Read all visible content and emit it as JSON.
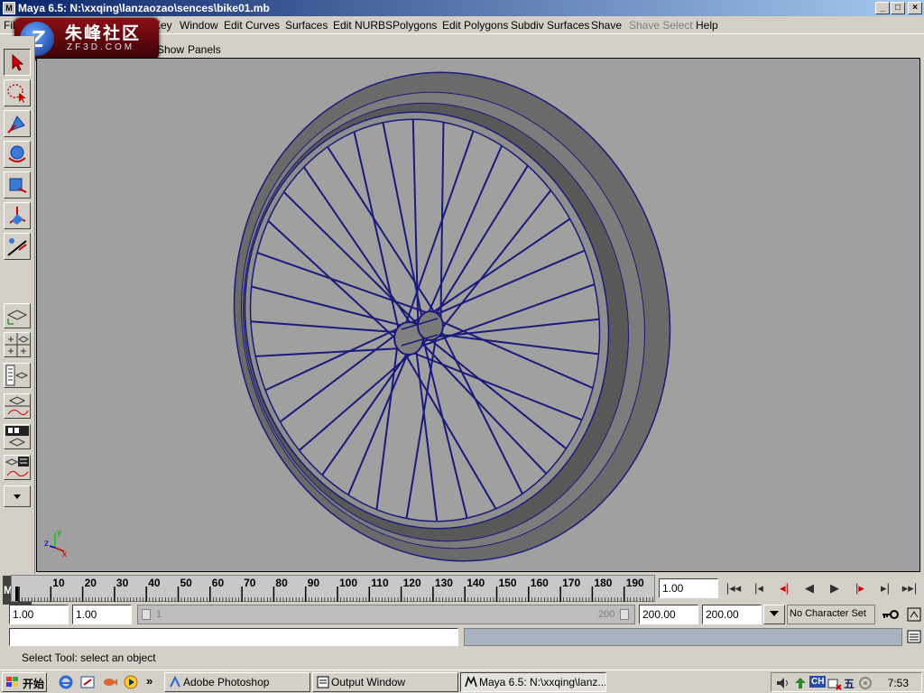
{
  "window": {
    "title": "Maya 6.5: N:\\xxqing\\lanzaozao\\sences\\bike01.mb",
    "min_glyph": "_",
    "max_glyph": "□",
    "close_glyph": "×"
  },
  "watermark": {
    "chinese": "朱峰社区",
    "site": "ZF3D.COM",
    "mark": "Z"
  },
  "menubar": {
    "items": [
      {
        "label": "File",
        "enabled": true
      },
      {
        "label": "Key",
        "enabled": true
      },
      {
        "label": "Window",
        "enabled": true
      },
      {
        "label": "Edit Curves",
        "enabled": true
      },
      {
        "label": "Surfaces",
        "enabled": true
      },
      {
        "label": "Edit NURBS",
        "enabled": true
      },
      {
        "label": "Polygons",
        "enabled": true
      },
      {
        "label": "Edit Polygons",
        "enabled": true
      },
      {
        "label": "Subdiv Surfaces",
        "enabled": true
      },
      {
        "label": "Shave",
        "enabled": true
      },
      {
        "label": "Shave Select",
        "enabled": false
      },
      {
        "label": "Help",
        "enabled": true
      }
    ]
  },
  "panel_menu": {
    "items": [
      "Show",
      "Panels"
    ]
  },
  "toolbox": {
    "tools": [
      "select-tool",
      "lasso-tool",
      "move-tool",
      "rotate-tool",
      "scale-tool",
      "manipulator-tool",
      "last-used-tool"
    ],
    "maya_logo": "Maya"
  },
  "viewport": {
    "axis_labels": {
      "x": "x",
      "y": "y",
      "z": "z"
    },
    "background": "#a0a0a0",
    "wire_color": "#1a1a7a"
  },
  "time_slider": {
    "ticks": [
      "10",
      "20",
      "30",
      "40",
      "50",
      "60",
      "70",
      "80",
      "90",
      "100",
      "110",
      "120",
      "130",
      "140",
      "150",
      "160",
      "170",
      "180",
      "190",
      "2"
    ],
    "current_time": "1.00"
  },
  "range_slider": {
    "start_time": "1.00",
    "playback_start": "1.00",
    "range_start_label": "1",
    "range_end_label": "200",
    "playback_end": "200.00",
    "end_time": "200.00",
    "character_set": "No Character Set"
  },
  "playback": {
    "buttons": [
      {
        "name": "go-to-start",
        "glyph": "|◂◂"
      },
      {
        "name": "step-back-key",
        "glyph": "|◂"
      },
      {
        "name": "step-back-frame",
        "glyph": "◂|"
      },
      {
        "name": "play-backward",
        "glyph": "◀"
      },
      {
        "name": "play-forward",
        "glyph": "▶"
      },
      {
        "name": "step-forward-frame",
        "glyph": "|▸"
      },
      {
        "name": "step-forward-key",
        "glyph": "▸|"
      },
      {
        "name": "go-to-end",
        "glyph": "▸▸|"
      }
    ]
  },
  "help_line": {
    "text": "Select Tool: select an object"
  },
  "taskbar": {
    "start_label": "开始",
    "tasks": [
      {
        "label": "Adobe Photoshop",
        "active": false
      },
      {
        "label": "Output Window",
        "active": false
      },
      {
        "label": "Maya 6.5: N:\\xxqing\\lanz...",
        "active": true
      }
    ],
    "tray": {
      "ime": "CH",
      "ime2": "五",
      "clock": "7:53"
    },
    "quicklaunch_more": "»"
  }
}
